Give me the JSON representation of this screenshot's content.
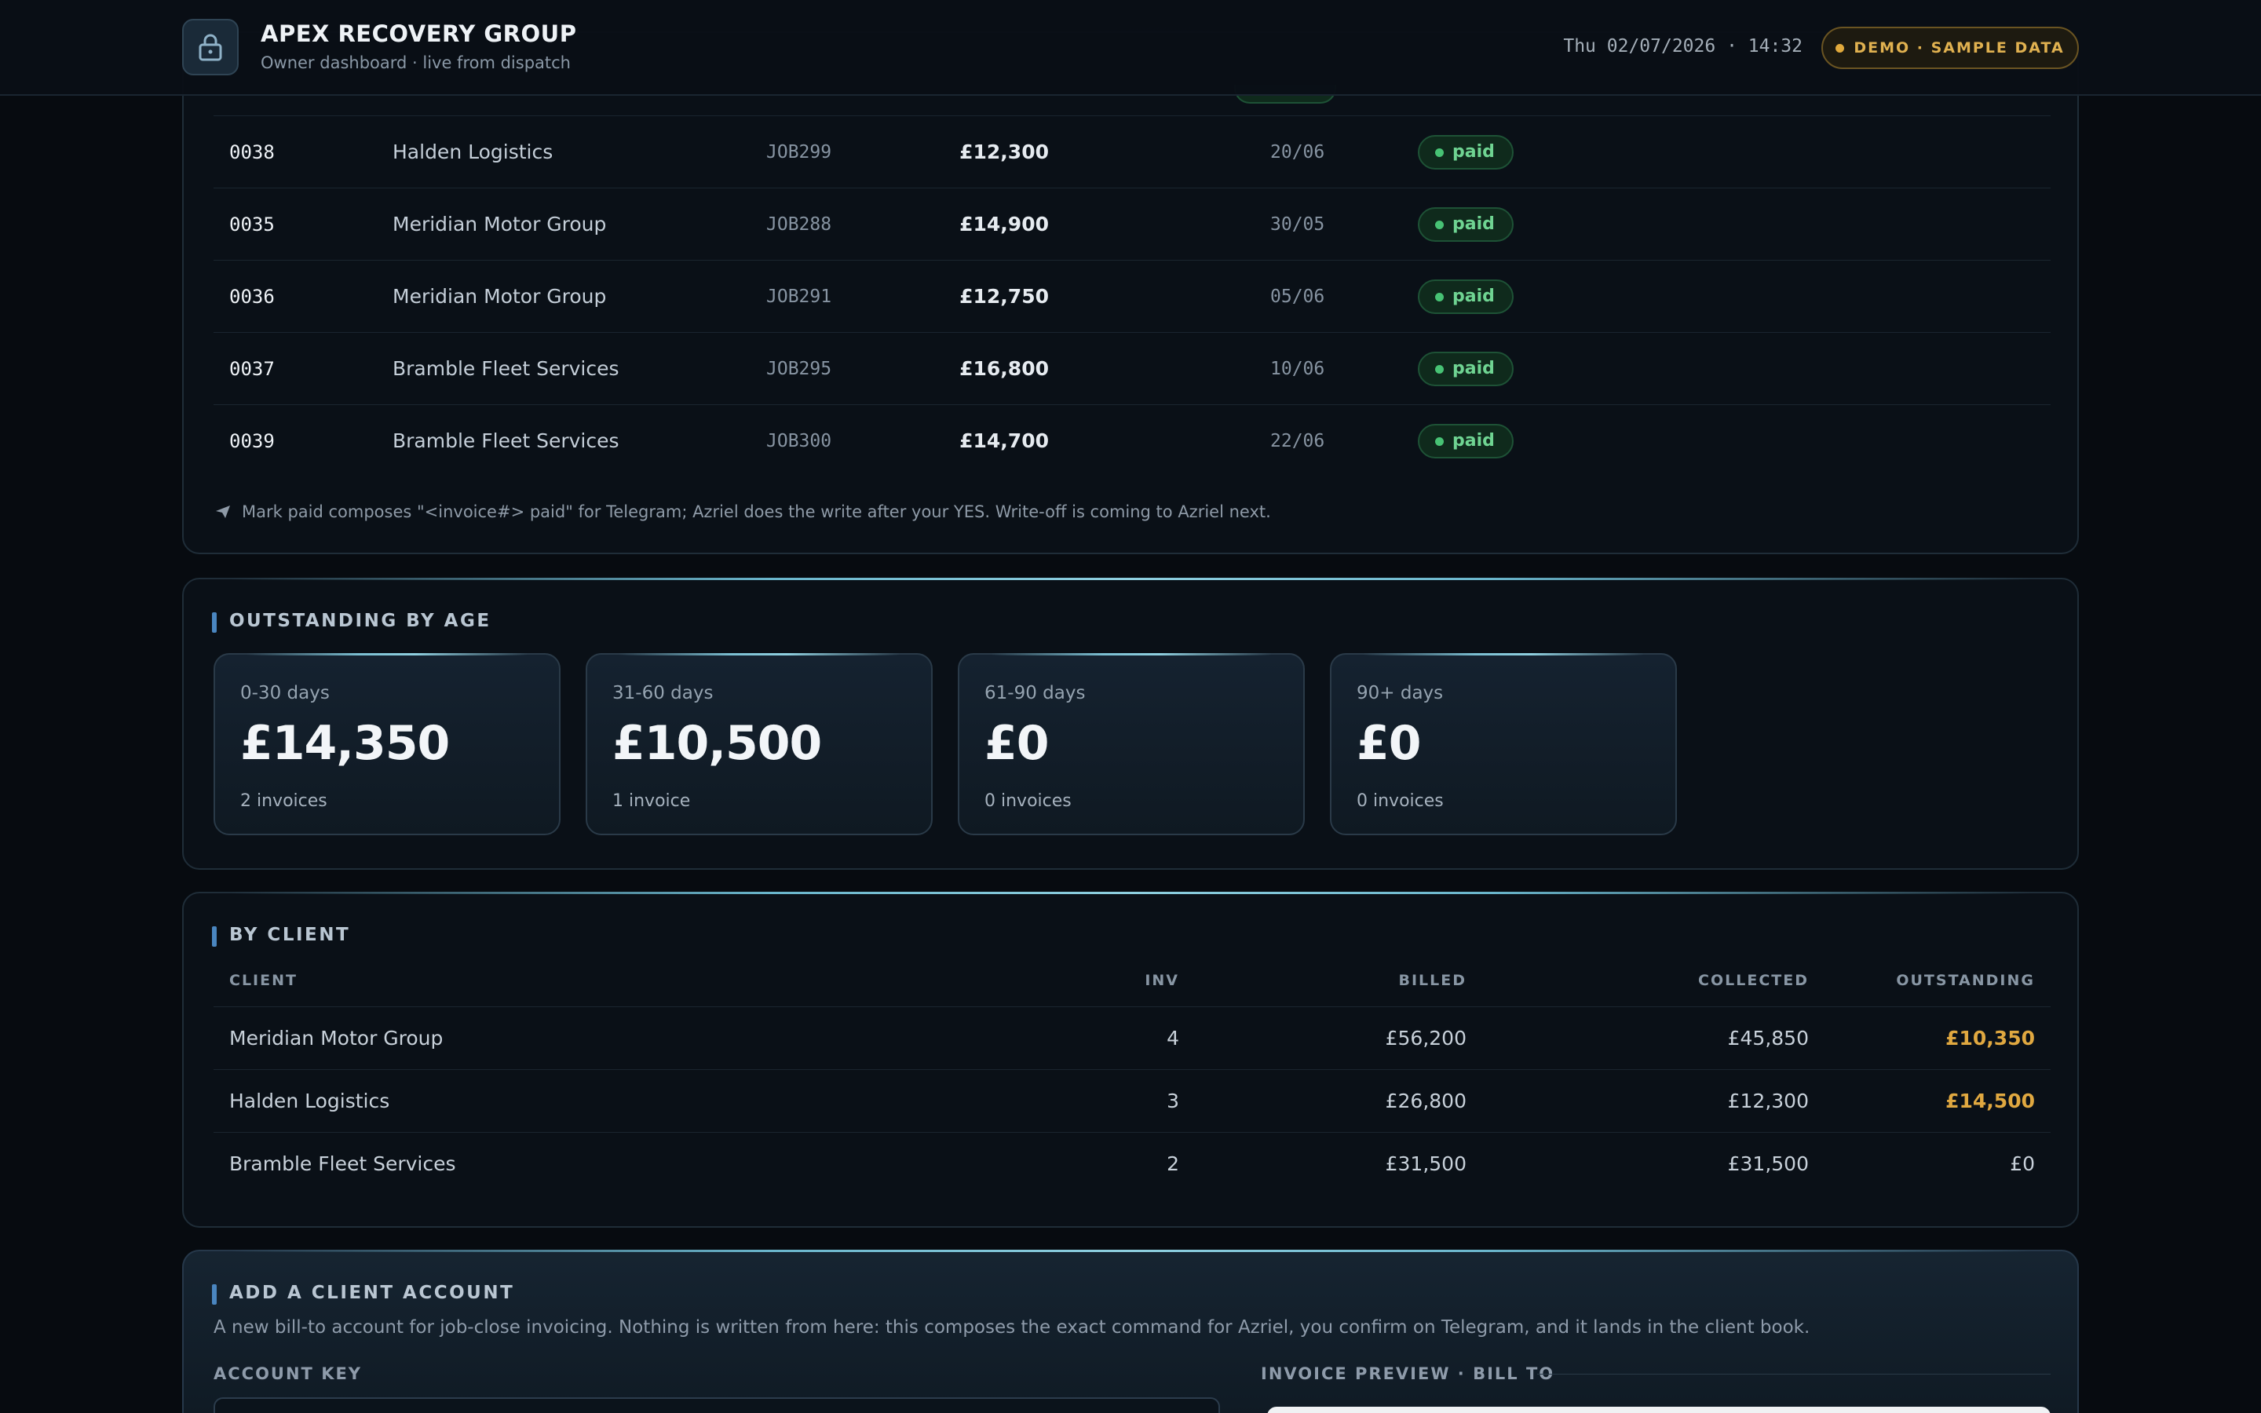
{
  "header": {
    "title": "APEX RECOVERY GROUP",
    "subtitle": "Owner dashboard · live from dispatch",
    "datetime": "Thu 02/07/2026 · 14:32",
    "badge": "DEMO · SAMPLE DATA",
    "icon": "lock-icon"
  },
  "invoices": {
    "rows": [
      {
        "num": "0038",
        "client": "Halden Logistics",
        "job": "JOB299",
        "amount": "£12,300",
        "date": "20/06",
        "status": "paid"
      },
      {
        "num": "0035",
        "client": "Meridian Motor Group",
        "job": "JOB288",
        "amount": "£14,900",
        "date": "30/05",
        "status": "paid"
      },
      {
        "num": "0036",
        "client": "Meridian Motor Group",
        "job": "JOB291",
        "amount": "£12,750",
        "date": "05/06",
        "status": "paid"
      },
      {
        "num": "0037",
        "client": "Bramble Fleet Services",
        "job": "JOB295",
        "amount": "£16,800",
        "date": "10/06",
        "status": "paid"
      },
      {
        "num": "0039",
        "client": "Bramble Fleet Services",
        "job": "JOB300",
        "amount": "£14,700",
        "date": "22/06",
        "status": "paid"
      }
    ],
    "note": "Mark paid composes \"<invoice#> paid\" for Telegram; Azriel does the write after your YES. Write-off is coming to Azriel next.",
    "note_icon": "send-icon"
  },
  "age": {
    "title": "OUTSTANDING BY AGE",
    "buckets": [
      {
        "label": "0-30 days",
        "value": "£14,350",
        "count": "2 invoices"
      },
      {
        "label": "31-60 days",
        "value": "£10,500",
        "count": "1 invoice"
      },
      {
        "label": "61-90 days",
        "value": "£0",
        "count": "0 invoices"
      },
      {
        "label": "90+ days",
        "value": "£0",
        "count": "0 invoices"
      }
    ]
  },
  "by_client": {
    "title": "BY CLIENT",
    "headers": {
      "client": "CLIENT",
      "inv": "INV",
      "billed": "BILLED",
      "collected": "COLLECTED",
      "outstanding": "OUTSTANDING"
    },
    "rows": [
      {
        "client": "Meridian Motor Group",
        "inv": "4",
        "billed": "£56,200",
        "collected": "£45,850",
        "outstanding": "£10,350"
      },
      {
        "client": "Halden Logistics",
        "inv": "3",
        "billed": "£26,800",
        "collected": "£12,300",
        "outstanding": "£14,500"
      },
      {
        "client": "Bramble Fleet Services",
        "inv": "2",
        "billed": "£31,500",
        "collected": "£31,500",
        "outstanding": "£0"
      }
    ],
    "warn_color": "#e0a840"
  },
  "add_client": {
    "title": "ADD A CLIENT ACCOUNT",
    "description": "A new bill-to account for job-close invoicing. Nothing is written from here: this composes the exact command for Azriel, you confirm on Telegram, and it lands in the client book.",
    "account_key_label": "ACCOUNT KEY",
    "preview_label": "INVOICE PREVIEW · BILL TO"
  }
}
